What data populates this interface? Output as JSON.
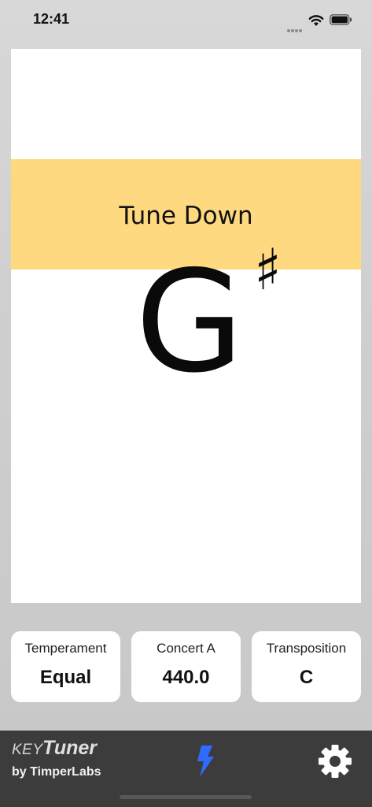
{
  "status_bar": {
    "time": "12:41"
  },
  "tuner": {
    "instruction": "Tune Down",
    "note": "G",
    "accidental": "♯",
    "band_color": "#ffd980"
  },
  "settings": [
    {
      "label": "Temperament",
      "value": "Equal"
    },
    {
      "label": "Concert A",
      "value": "440.0"
    },
    {
      "label": "Transposition",
      "value": "C"
    }
  ],
  "brand": {
    "key": "KEY",
    "tuner": "Tuner",
    "by": "by TimperLabs"
  },
  "icons": {
    "bolt": "bolt-icon",
    "gear": "gear-icon",
    "accent_color": "#2f6bff"
  }
}
